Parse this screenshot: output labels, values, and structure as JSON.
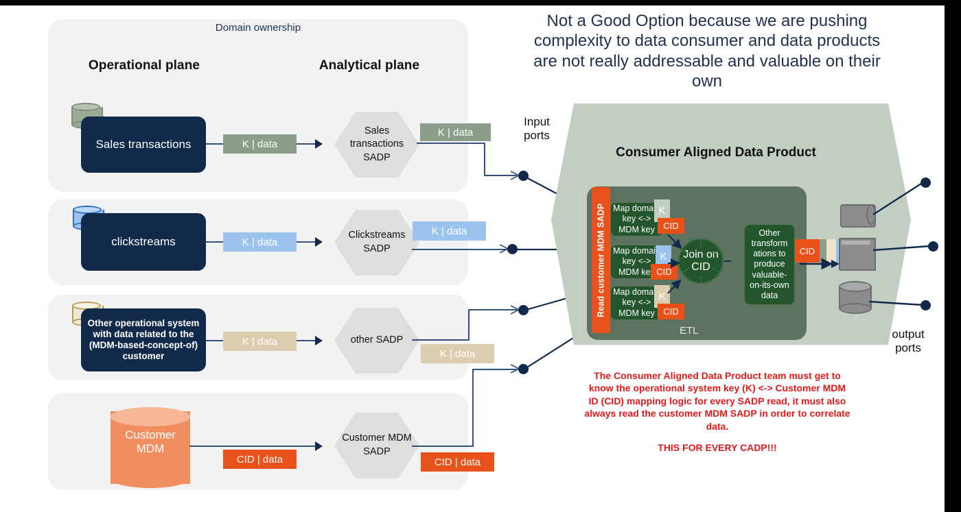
{
  "headline": "Not a Good Option because we are pushing complexity  to data consumer and data products are not really addressable and valuable on their own",
  "left": {
    "panel_title": "Domain ownership",
    "plane_operational": "Operational plane",
    "plane_analytical": "Analytical plane",
    "rows": [
      {
        "source": "Sales transactions",
        "source_icon": "database-cylinder-icon",
        "sadp": "Sales transactions SADP",
        "chip_in": "K | data",
        "chip_out": "K | data",
        "accent": "#8a9e89",
        "chip_text": "#ffffff"
      },
      {
        "source": "clickstreams",
        "source_icon": "database-cylinder-icon",
        "sadp": "Clickstreams SADP",
        "chip_in": "K | data",
        "chip_out": "K | data",
        "accent": "#9cc3ee",
        "chip_text": "#ffffff"
      },
      {
        "source": "Other operational system with data related to the (MDM-based-concept-of) customer",
        "source_icon": "database-cylinder-icon",
        "sadp": "other SADP",
        "chip_in": "K | data",
        "chip_out": "K | data",
        "accent": "#ddcdaf",
        "chip_text": "#ffffff"
      },
      {
        "source": "Customer MDM",
        "source_icon": "database-cylinder-icon",
        "sadp": "Customer MDM SADP",
        "chip_in": "CID | data",
        "chip_out": "CID | data",
        "accent": "#e8521a",
        "chip_text": "#ffffff"
      }
    ]
  },
  "ports": {
    "input_label": "Input ports",
    "output_label": "output ports"
  },
  "cadp": {
    "title": "Consumer Aligned Data Product",
    "read_mdm": "Read customer MDM SADP",
    "etl_label": "ETL",
    "map_cards": [
      {
        "text": "Map domain key <-> MDM key",
        "k": "K",
        "k_bg": "#c3cec3",
        "cid": "CID"
      },
      {
        "text": "Map domain key <-> MDM key",
        "k": "K",
        "k_bg": "#9cc3ee",
        "cid": "CID"
      },
      {
        "text": "Map domain key <-> MDM key",
        "k": "K",
        "k_bg": "#ddcdaf",
        "cid": "CID"
      }
    ],
    "join": "Join on CID",
    "transform": "Other transform ations to produce valuable-on-its-own data",
    "out_cid": "CID",
    "out_strips": [
      "#8a9e89",
      "#f0e2c8",
      "#9cc3ee"
    ]
  },
  "warning": {
    "main": "The Consumer Aligned Data Product team must get to know the operational system key (K) <-> Customer MDM ID (CID) mapping logic for every SADP read, it must also always read the customer MDM SADP in order to correlate data.",
    "emphasis": "THIS FOR EVERY CADP!!!"
  },
  "colors": {
    "navy": "#11294b",
    "orange": "#e8521a",
    "cadp_green": "#c3cec3",
    "etl_green": "#5d7360",
    "card_green": "#23562c",
    "red": "#e01a1a",
    "panel_bg": "#f2f2f2"
  }
}
